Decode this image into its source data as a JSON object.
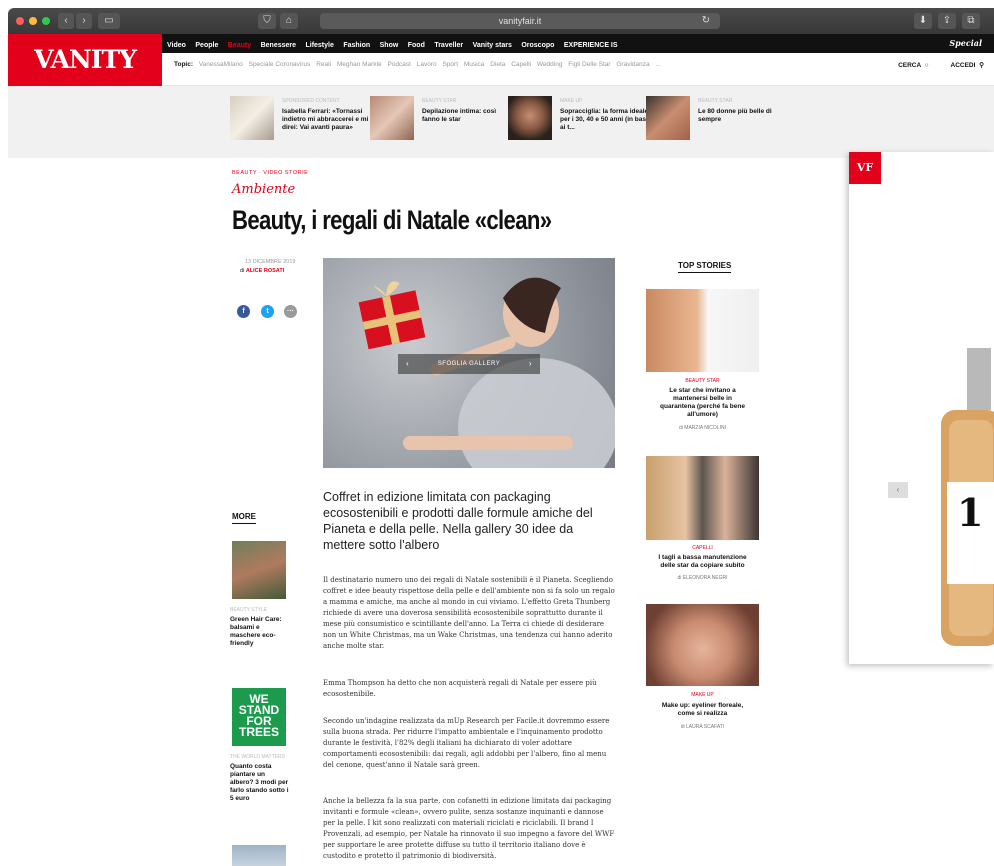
{
  "browser": {
    "url": "vanityfair.it"
  },
  "site": {
    "logo": "VANITY FAIR",
    "nav": [
      "Video",
      "People",
      "Beauty",
      "Benessere",
      "Lifestyle",
      "Fashion",
      "Show",
      "Food",
      "Traveller",
      "Vanity stars",
      "Oroscopo",
      "EXPERIENCE IS"
    ],
    "nav_active": "Beauty",
    "brand_script": "Special",
    "topics_label": "Topic:",
    "topics": [
      "VanessaMilano",
      "Speciale Coronavirus",
      "Reali",
      "Meghan Markle",
      "Podcast",
      "Lavoro",
      "Sport",
      "Musica",
      "Dieta",
      "Capelli",
      "Wedding",
      "Figli Delle Star",
      "Gravidanza",
      "..."
    ],
    "search_label": "CERCA",
    "login_label": "ACCEDI"
  },
  "featured": [
    {
      "kicker": "SPONSORED CONTENT",
      "title": "Isabella Ferrari: «Tornassi indietro mi abbraccerei e mi direi: Vai avanti paura»"
    },
    {
      "kicker": "BEAUTY STAR",
      "title": "Depilazione intima: così fanno le star"
    },
    {
      "kicker": "MAKE UP",
      "title": "Sopracciglia: la forma ideale per i 30, 40 e 50 anni (in base ai t..."
    },
    {
      "kicker": "BEAUTY STAR",
      "title": "Le 80 donne più belle di sempre"
    }
  ],
  "article": {
    "kickers": "BEAUTY · VIDEO STORIE",
    "category": "Ambiente",
    "title": "Beauty, i regali di Natale «clean»",
    "date": "13 DICEMBRE 2019",
    "author_prefix": "di",
    "author": "ALICE ROSATI",
    "gallery_label": "SFOGLIA GALLERY",
    "lede": "Coffret in edizione limitata con packaging ecosostenibili e prodotti dalle formule amiche del Pianeta e della pelle. Nella gallery 30 idee da mettere sotto l'albero",
    "p1": "Il destinatario numero uno dei regali di Natale sostenibili è il Pianeta. Scegliendo coffret e idee beauty rispettose della pelle e dell'ambiente non si fa solo un regalo a mamma e amiche, ma anche al mondo in cui viviamo. L'effetto Greta Thunberg richiede di avere una doverosa sensibilità ecosostenibile soprattutto durante il mese più consumistico e scintillante dell'anno. La Terra ci chiede di desiderare non un White Christmas, ma un Wake Christmas, una tendenza cui hanno aderito anche molte star.",
    "p2": "Emma Thompson ha detto che non acquisterà regali di Natale per essere più ecosostenibile.",
    "p3": "Secondo un'indagine realizzata da mUp Research per Facile.it dovremmo essere sulla buona strada. Per ridurre l'impatto ambientale e l'inquinamento prodotto durante le festività, l'82% degli italiani ha dichiarato di voler adottare comportamenti ecosostenibili: dai regali, agli addobbi per l'albero, fino al menu del cenone, quest'anno il Natale sarà green.",
    "p4": "Anche la bellezza fa la sua parte, con cofanetti in edizione limitata dai packaging invitanti e formule «clean», ovvero pulite, senza sostanze inquinanti e dannose per la pelle. I kit sono realizzati con materiali riciclati e riciclabili. Il brand I Provenzali, ad esempio, per Natale ha rinnovato il suo impegno a favore del WWF per supportare le aree protette diffuse su tutto il territorio italiano dove è custodito e protetto il patrimonio di biodiversità."
  },
  "more": {
    "title": "MORE",
    "items": [
      {
        "kicker": "BEAUTY STYLE",
        "title": "Green Hair Care: balsami e maschere eco-friendly"
      },
      {
        "badge": "WE STAND FOR TREES",
        "kicker": "THE WORLD MATTERS",
        "title": "Quanto costa piantare un albero? 3 modi per farlo stando sotto i 5 euro"
      }
    ]
  },
  "top_stories": {
    "title": "TOP STORIES",
    "items": [
      {
        "kicker": "BEAUTY STAR",
        "title": "Le star che invitano a mantenersi belle in quarantena (perché fa bene all'umore)",
        "author": "di MARZIA NICOLINI"
      },
      {
        "kicker": "CAPELLI",
        "title": "I tagli a bassa manutenzione delle star da copiare subito",
        "author": "di ELEONORA NEGRI"
      },
      {
        "kicker": "MAKE UP",
        "title": "Make up: eyeliner floreale, come si realizza",
        "author": "di LAURA SCAFATI"
      }
    ]
  },
  "ad": {
    "logo": "VF",
    "number": "1"
  },
  "colors": {
    "brand": "#e2001a",
    "facebook": "#3b5998",
    "twitter": "#1da1f2"
  }
}
